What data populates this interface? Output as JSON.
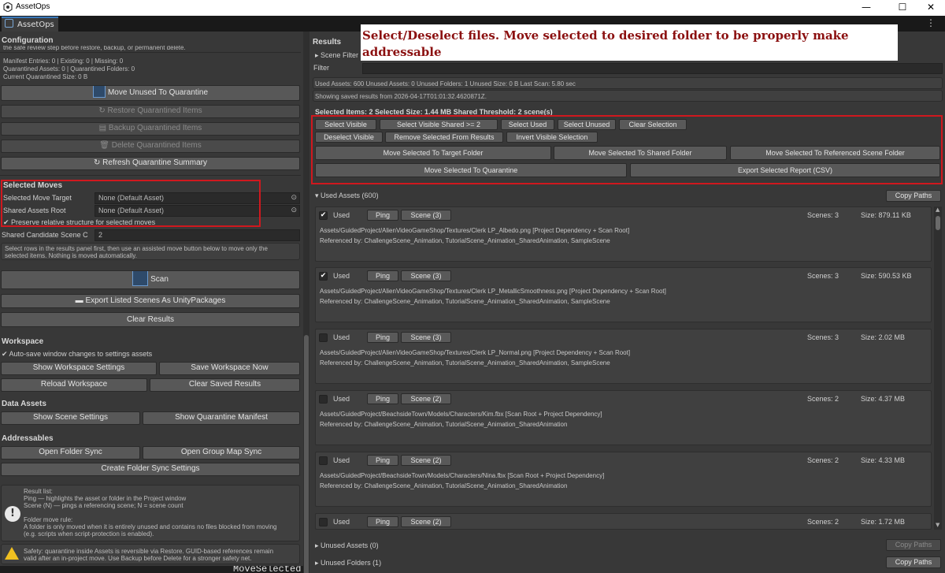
{
  "window": {
    "title": "AssetOps",
    "tab": "AssetOps",
    "minimize": "—",
    "maximize": "☐",
    "close": "✕",
    "more": "⋮"
  },
  "left": {
    "config_header": "Configuration",
    "clipped_text": "the safe review step before restore, backup, or permanent delete.",
    "stats": [
      "Manifest Entries: 0  |  Existing: 0  |  Missing: 0",
      "Quarantined Assets: 0  |  Quarantined Folders: 0",
      "Current Quarantined Size: 0 B"
    ],
    "buttons": {
      "move_unused": "Move Unused To Quarantine",
      "restore": "Restore Quarantined Items",
      "backup": "Backup Quarantined Items",
      "delete": "Delete Quarantined Items",
      "refresh": "Refresh Quarantine Summary"
    },
    "selected_moves": {
      "header": "Selected Moves",
      "target_label": "Selected Move Target",
      "target_value": "None (Default Asset)",
      "shared_label": "Shared Assets Root",
      "shared_value": "None (Default Asset)",
      "preserve_label": "Preserve relative structure for selected moves"
    },
    "shared_candidate_label": "Shared Candidate Scene C",
    "shared_candidate_value": "2",
    "help1": [
      "Select rows in the results panel first, then use an assisted move button below to move only the",
      "selected items. Nothing is moved automatically."
    ],
    "scan": "Scan",
    "export_scenes": "Export Listed Scenes As UnityPackages",
    "clear_results": "Clear Results",
    "workspace": {
      "header": "Workspace",
      "autosave": "Auto-save window changes to settings assets",
      "show_settings": "Show Workspace Settings",
      "save_now": "Save Workspace Now",
      "reload": "Reload Workspace",
      "clear_saved": "Clear Saved Results"
    },
    "data_assets": {
      "header": "Data Assets",
      "show_scene": "Show Scene Settings",
      "show_manifest": "Show Quarantine Manifest"
    },
    "addressables": {
      "header": "Addressables",
      "open_folder_sync": "Open Folder Sync",
      "open_group_map": "Open Group Map Sync",
      "create_folder_sync": "Create Folder Sync Settings"
    },
    "info_lines": [
      "Result list:",
      "  Ping — highlights the asset or folder in the Project window",
      "  Scene (N) — pings a referencing scene; N = scene count",
      "",
      "Folder move rule:",
      "  A folder is only moved when it is entirely unused and contains no files blocked from moving",
      "  (e.g. scripts when script-protection is enabled)."
    ],
    "safety_lines": [
      "Safety: quarantine inside Assets is reversible via Restore. GUID-based references remain",
      "valid after an in-project move. Use Backup before Delete for a stronger safety net."
    ],
    "bottom_code": "MoveSelectedToQuarantine();"
  },
  "right": {
    "results_header": "Results",
    "annotation": "Select/Deselect files. Move selected to desired folder to be properly make addressable",
    "scene_filter": "Scene Filter",
    "filter_label": "Filter",
    "summary": "Used Assets: 600    Unused Assets: 0    Unused Folders: 1    Unused Size: 0 B    Last Scan: 5.80 sec",
    "saved_results": "Showing saved results from 2026-04-17T01:01:32.4620871Z.",
    "selection_info": "Selected Items: 2    Selected Size: 1.44 MB    Shared Threshold: 2 scene(s)",
    "sel_buttons": {
      "select_visible": "Select Visible",
      "select_visible_shared": "Select Visible Shared >= 2",
      "select_used": "Select Used",
      "select_unused": "Select Unused",
      "clear_selection": "Clear Selection",
      "deselect_visible": "Deselect Visible",
      "remove_selected": "Remove Selected From Results",
      "invert_visible": "Invert Visible Selection",
      "move_target": "Move Selected To Target Folder",
      "move_shared": "Move Selected To Shared Folder",
      "move_ref_scene": "Move Selected To Referenced Scene Folder",
      "move_quarantine": "Move Selected To Quarantine",
      "export_report": "Export Selected Report (CSV)"
    },
    "used_assets_header": "Used Assets (600)",
    "copy_paths": "Copy Paths",
    "items": [
      {
        "checked": "✔",
        "status": "Used",
        "ping": "Ping",
        "scene": "Scene (3)",
        "scenes": "Scenes: 3",
        "size": "Size: 879.11 KB",
        "path": "Assets/GuidedProject/AlienVideoGameShop/Textures/Clerk LP_Albedo.png     [Project Dependency + Scan Root]",
        "refs": "Referenced by: ChallengeScene_Animation, TutorialScene_Animation_SharedAnimation, SampleScene"
      },
      {
        "checked": "✔",
        "status": "Used",
        "ping": "Ping",
        "scene": "Scene (3)",
        "scenes": "Scenes: 3",
        "size": "Size: 590.53 KB",
        "path": "Assets/GuidedProject/AlienVideoGameShop/Textures/Clerk LP_MetallicSmoothness.png     [Project Dependency + Scan Root]",
        "refs": "Referenced by: ChallengeScene_Animation, TutorialScene_Animation_SharedAnimation, SampleScene"
      },
      {
        "checked": "",
        "status": "Used",
        "ping": "Ping",
        "scene": "Scene (3)",
        "scenes": "Scenes: 3",
        "size": "Size: 2.02 MB",
        "path": "Assets/GuidedProject/AlienVideoGameShop/Textures/Clerk LP_Normal.png     [Project Dependency + Scan Root]",
        "refs": "Referenced by: ChallengeScene_Animation, TutorialScene_Animation_SharedAnimation, SampleScene"
      },
      {
        "checked": "",
        "status": "Used",
        "ping": "Ping",
        "scene": "Scene (2)",
        "scenes": "Scenes: 2",
        "size": "Size: 4.37 MB",
        "path": "Assets/GuidedProject/BeachsideTown/Models/Characters/Kim.fbx     [Scan Root + Project Dependency]",
        "refs": "Referenced by: ChallengeScene_Animation, TutorialScene_Animation_SharedAnimation"
      },
      {
        "checked": "",
        "status": "Used",
        "ping": "Ping",
        "scene": "Scene (2)",
        "scenes": "Scenes: 2",
        "size": "Size: 4.33 MB",
        "path": "Assets/GuidedProject/BeachsideTown/Models/Characters/Nina.fbx     [Scan Root + Project Dependency]",
        "refs": "Referenced by: ChallengeScene_Animation, TutorialScene_Animation_SharedAnimation"
      },
      {
        "checked": "",
        "status": "Used",
        "ping": "Ping",
        "scene": "Scene (2)",
        "scenes": "Scenes: 2",
        "size": "Size: 1.72 MB",
        "path": "",
        "refs": ""
      }
    ],
    "unused_assets": "Unused Assets (0)",
    "unused_folders": "Unused Folders (1)",
    "copy_paths_dis": "Copy Paths",
    "copy_paths_folders": "Copy Paths"
  }
}
